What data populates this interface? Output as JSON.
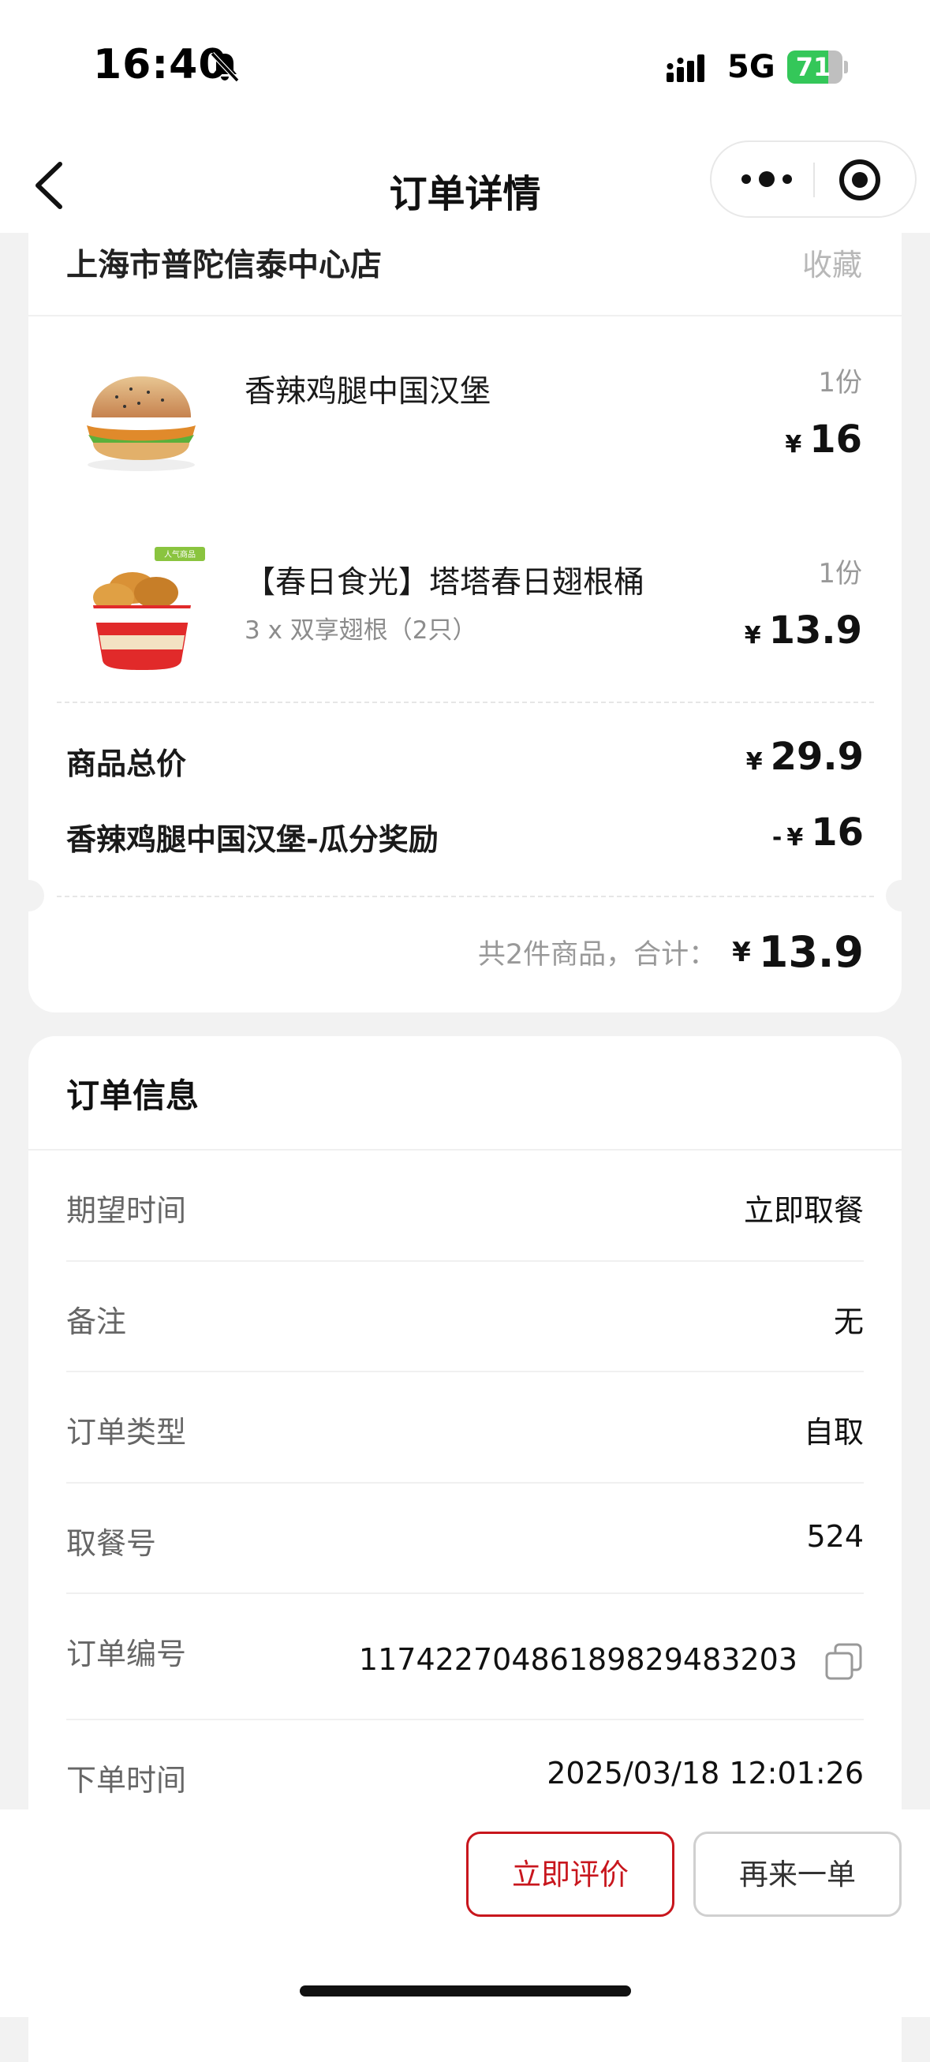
{
  "status_bar": {
    "time": "16:40",
    "network": "5G",
    "battery": "71"
  },
  "nav": {
    "title": "订单详情"
  },
  "order": {
    "store_name": "上海市普陀信泰中心店",
    "favorite_label": "收藏",
    "items": [
      {
        "name": "香辣鸡腿中国汉堡",
        "sub": "",
        "qty": "1份",
        "currency": "¥",
        "price": "16",
        "badge": ""
      },
      {
        "name": "【春日食光】塔塔春日翅根桶",
        "sub": "3 x 双享翅根（2只）",
        "qty": "1份",
        "currency": "¥",
        "price": "13.9",
        "badge": "人气商品"
      }
    ],
    "subtotal": {
      "label": "商品总价",
      "currency": "¥",
      "value": "29.9"
    },
    "discount": {
      "label": "香辣鸡腿中国汉堡-瓜分奖励",
      "prefix": "-",
      "currency": "¥",
      "value": "16"
    },
    "total": {
      "label": "共2件商品，合计：",
      "currency": "¥",
      "value": "13.9"
    }
  },
  "info": {
    "title": "订单信息",
    "rows": [
      {
        "key": "期望时间",
        "value": "立即取餐"
      },
      {
        "key": "备注",
        "value": "无"
      },
      {
        "key": "订单类型",
        "value": "自取"
      },
      {
        "key": "取餐号",
        "value": "524"
      },
      {
        "key": "订单编号",
        "value": "1174227048618982948​3203"
      },
      {
        "key": "下单时间",
        "value": "2025/03/18 12:01:26"
      }
    ]
  },
  "actions": {
    "review": "立即评价",
    "reorder": "再来一单"
  },
  "colors": {
    "accent": "#c8161d",
    "battery": "#34c759"
  },
  "icons": [
    "back-icon",
    "more-icon",
    "target-icon",
    "bell-off-icon",
    "signal-icon",
    "battery-icon",
    "copy-icon"
  ]
}
